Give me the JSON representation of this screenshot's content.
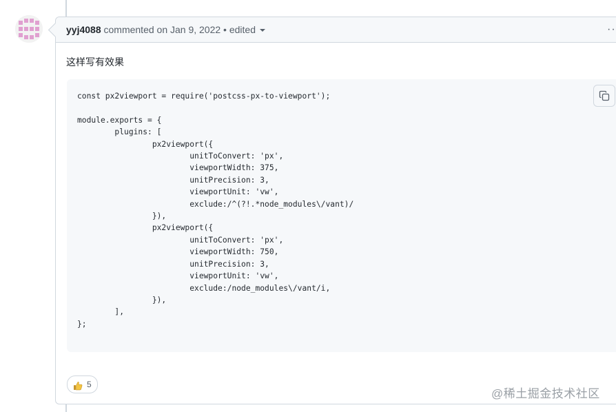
{
  "comment": {
    "author": "yyj4088",
    "meta_text": "commented on Jan 9, 2022 • edited",
    "options_glyph": "···",
    "body_text": "这样写有效果",
    "code": "const px2viewport = require('postcss-px-to-viewport');\n\nmodule.exports = {\n        plugins: [\n                px2viewport({\n                        unitToConvert: 'px',\n                        viewportWidth: 375,\n                        unitPrecision: 3,\n                        viewportUnit: 'vw',\n                        exclude:/^(?!.*node_modules\\/vant)/\n                }),\n                px2viewport({\n                        unitToConvert: 'px',\n                        viewportWidth: 750,\n                        unitPrecision: 3,\n                        viewportUnit: 'vw',\n                        exclude:/node_modules\\/vant/i,\n                }),\n        ],\n};",
    "reaction": {
      "icon": "thumbs-up-icon",
      "count": "5"
    }
  },
  "watermark": "@稀土掘金技术社区",
  "colors": {
    "avatar_accent": "#e0a0d0",
    "border": "#d0d7de",
    "header_bg": "#f6f8fa",
    "code_bg": "#f6f8fa",
    "text_muted": "#57606a"
  }
}
